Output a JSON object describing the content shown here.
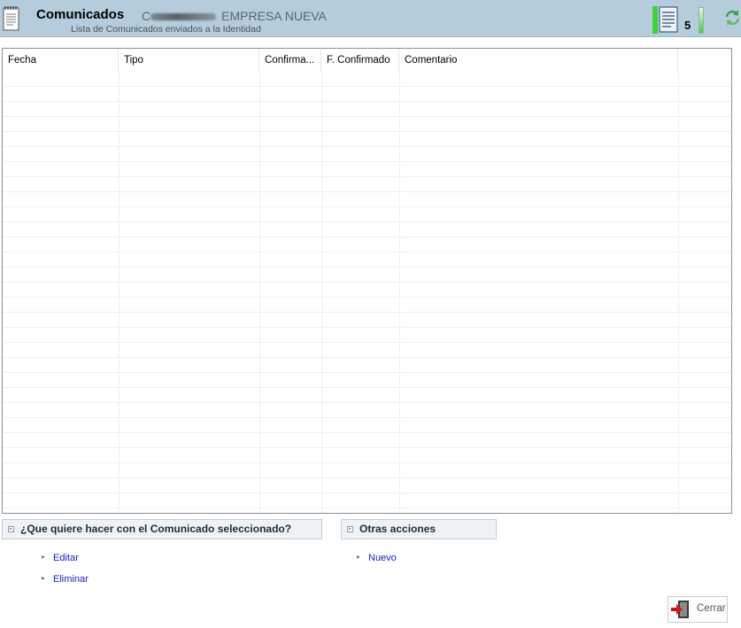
{
  "header": {
    "title": "Comunicados",
    "entity_name": "EMPRESA NUEVA",
    "entity_prefix": "C",
    "subtitle": "Lista de Comunicados enviados a la Identidad",
    "counter": "5"
  },
  "grid": {
    "columns": [
      {
        "key": "fecha",
        "label": "Fecha"
      },
      {
        "key": "tipo",
        "label": "Tipo"
      },
      {
        "key": "confirma",
        "label": "Confirma..."
      },
      {
        "key": "f_confirmado",
        "label": "F. Confirmado"
      },
      {
        "key": "comentario",
        "label": "Comentario"
      }
    ],
    "rows": []
  },
  "actions": {
    "selected_title": "¿Que quiere hacer con el Comunicado seleccionado?",
    "selected_items": [
      "Editar",
      "Eliminar"
    ],
    "other_title": "Otras acciones",
    "other_items": [
      "Nuevo"
    ]
  },
  "footer": {
    "close_label": "Cerrar"
  },
  "colors": {
    "header_bg": "#b4ccdb",
    "link": "#1a1ac0",
    "counter_green": "#3ecf3e"
  }
}
